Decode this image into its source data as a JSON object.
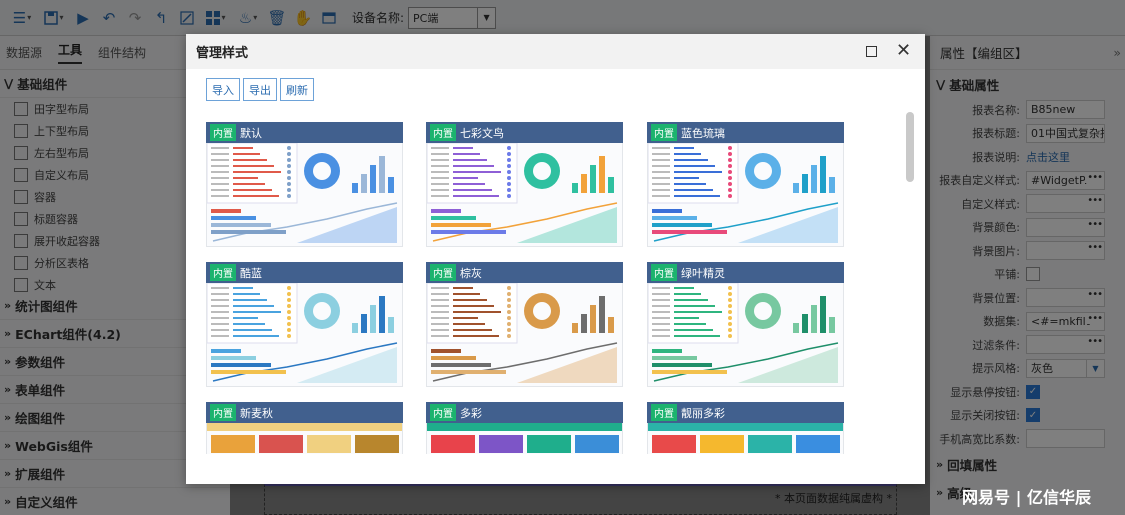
{
  "toolbar": {
    "icons": [
      "menu-icon",
      "save-icon",
      "play-icon",
      "undo-icon",
      "redo-icon",
      "back-icon",
      "edit-icon",
      "grid-icon",
      "paint-icon",
      "delete-icon",
      "hand-icon",
      "window-icon"
    ],
    "device_label": "设备名称:",
    "device_value": "PC端"
  },
  "left": {
    "tabs": [
      "数据源",
      "工具",
      "组件结构"
    ],
    "active_tab": "工具",
    "basic_title": "基础组件",
    "basic_items": [
      "田字型布局",
      "上下型布局",
      "左右型布局",
      "自定义布局",
      "容器",
      "标题容器",
      "展开收起容器",
      "分析区表格",
      "文本"
    ],
    "sections": [
      "统计图组件",
      "EChart组件(4.2)",
      "参数组件",
      "表单组件",
      "绘图组件",
      "WebGis组件",
      "扩展组件",
      "自定义组件"
    ]
  },
  "right": {
    "header": "属性【编组区】",
    "section_basic": "基础属性",
    "props": [
      {
        "label": "报表名称:",
        "value": "B85new",
        "type": "text"
      },
      {
        "label": "报表标题:",
        "value": "01中国式复杂报",
        "type": "text"
      },
      {
        "label": "报表说明:",
        "value": "点击这里",
        "type": "link"
      },
      {
        "label": "报表自定义样式:",
        "value": "#WidgetP.",
        "type": "dots"
      },
      {
        "label": "自定义样式:",
        "value": "",
        "type": "dots"
      },
      {
        "label": "背景颜色:",
        "value": "",
        "type": "dots"
      },
      {
        "label": "背景图片:",
        "value": "",
        "type": "dots"
      },
      {
        "label": "平铺:",
        "value": "",
        "type": "check"
      },
      {
        "label": "背景位置:",
        "value": "",
        "type": "dots"
      },
      {
        "label": "数据集:",
        "value": "<#=mkfilt",
        "type": "dots"
      },
      {
        "label": "过滤条件:",
        "value": "",
        "type": "dots"
      },
      {
        "label": "提示风格:",
        "value": "灰色",
        "type": "select"
      },
      {
        "label": "显示悬停按钮:",
        "value": "",
        "type": "checked"
      },
      {
        "label": "显示关闭按钮:",
        "value": "",
        "type": "checked"
      },
      {
        "label": "手机高宽比系数:",
        "value": "",
        "type": "text"
      }
    ],
    "section_fill": "回填属性",
    "section_advanced": "高级"
  },
  "canvas": {
    "note": "* 本页面数据纯属虚构 *"
  },
  "modal": {
    "title": "管理样式",
    "buttons": [
      "导入",
      "导出",
      "刷新"
    ],
    "badge": "内置",
    "styles": [
      {
        "name": "默认",
        "theme": "default"
      },
      {
        "name": "七彩文鸟",
        "theme": "colorful"
      },
      {
        "name": "蓝色琉璃",
        "theme": "blue"
      },
      {
        "name": "酷蓝",
        "theme": "coolblue"
      },
      {
        "name": "棕灰",
        "theme": "brown"
      },
      {
        "name": "绿叶精灵",
        "theme": "green"
      },
      {
        "name": "新麦秋",
        "theme": "autumn"
      },
      {
        "name": "多彩",
        "theme": "multi"
      },
      {
        "name": "靓丽多彩",
        "theme": "bright"
      }
    ]
  },
  "watermark": "网易号 | 亿信华辰"
}
